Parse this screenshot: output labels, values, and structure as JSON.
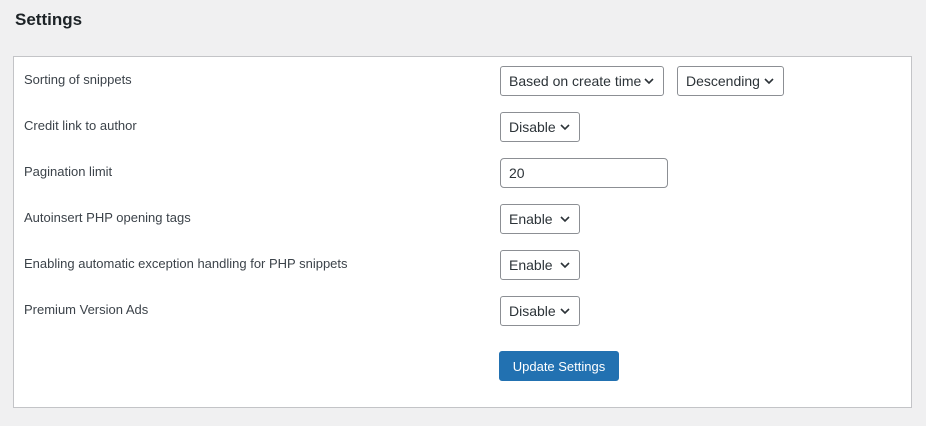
{
  "page": {
    "title": "Settings"
  },
  "settings": {
    "sorting": {
      "label": "Sorting of snippets",
      "order_by": "Based on create time",
      "direction": "Descending"
    },
    "credit_link": {
      "label": "Credit link to author",
      "value": "Disable"
    },
    "pagination": {
      "label": "Pagination limit",
      "value": "20"
    },
    "autoinsert_php": {
      "label": "Autoinsert PHP opening tags",
      "value": "Enable"
    },
    "exception_handling": {
      "label": "Enabling automatic exception handling for PHP snippets",
      "value": "Enable"
    },
    "premium_ads": {
      "label": "Premium Version Ads",
      "value": "Disable"
    }
  },
  "actions": {
    "update_label": "Update Settings"
  },
  "icons": {
    "dropdown": "chevron-down-icon"
  },
  "colors": {
    "primary_button": "#2271b1",
    "background": "#f0f0f1",
    "border": "#8c8f94"
  }
}
